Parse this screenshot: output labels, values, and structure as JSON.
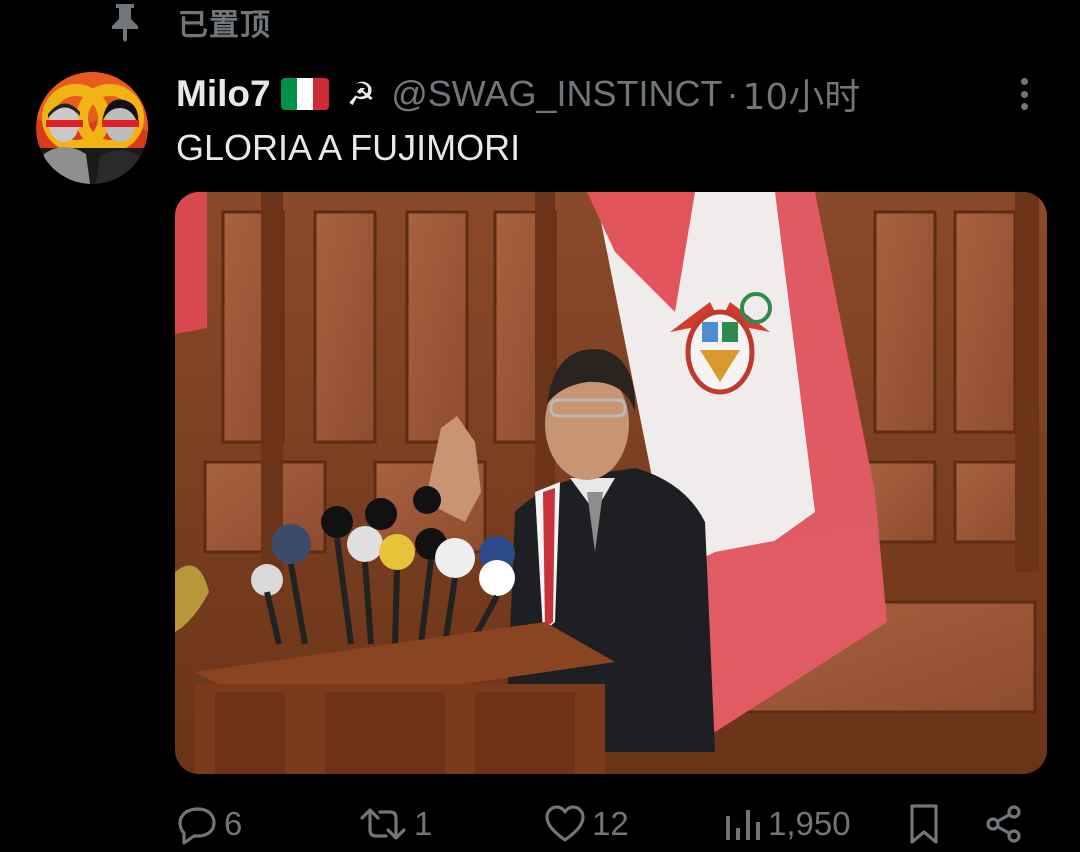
{
  "pinned": {
    "label": "已置顶",
    "icon": "pin-icon"
  },
  "tweet": {
    "author_name": "Milo7",
    "hammer_sickle": "☭",
    "handle": "@SWAG_INSTINCT",
    "separator": "·",
    "timestamp": "10小时",
    "text": "GLORIA A FUJIMORI",
    "flag_colors": [
      "#009246",
      "#ffffff",
      "#ce2b37"
    ]
  },
  "actions": {
    "replies": "6",
    "retweets": "1",
    "likes": "12",
    "views": "1,950"
  },
  "colors": {
    "background": "#000000",
    "text": "#e7e9ea",
    "muted": "#71767b"
  }
}
